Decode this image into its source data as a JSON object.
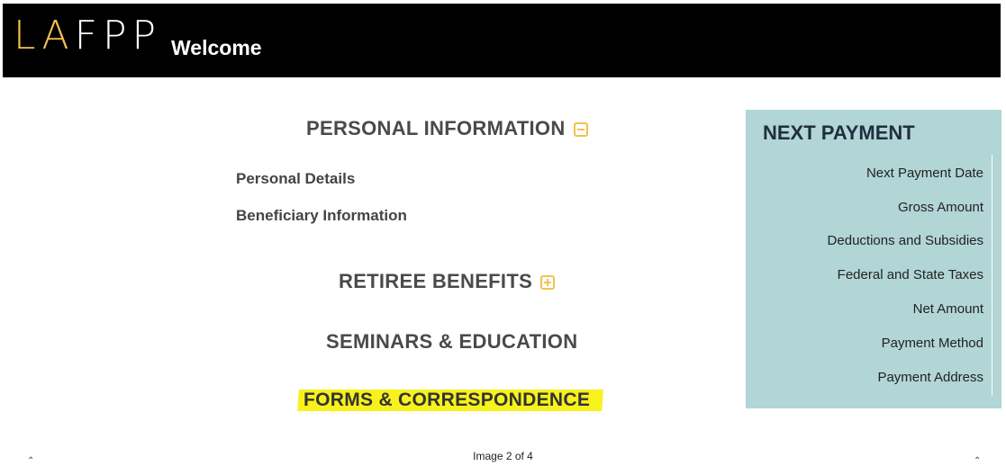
{
  "header": {
    "logo": "LAFPP",
    "welcome": "Welcome"
  },
  "personal_information": {
    "title": "PERSONAL INFORMATION",
    "toggle": "collapse",
    "links": [
      "Personal Details",
      "Beneficiary Information"
    ]
  },
  "retiree_benefits": {
    "title": "RETIREE BENEFITS",
    "toggle": "expand"
  },
  "seminars": {
    "title": "SEMINARS & EDUCATION"
  },
  "forms": {
    "title": "FORMS & CORRESPONDENCE",
    "highlight_color": "#f7f21b"
  },
  "next_payment": {
    "title": "NEXT PAYMENT",
    "items": [
      "Next Payment Date",
      "Gross Amount",
      "Deductions and Subsidies",
      "Federal and State Taxes",
      "Net Amount",
      "Payment Method",
      "Payment Address"
    ],
    "background": "#b2d5d6"
  },
  "footer": {
    "caption": "Image 2 of 4"
  },
  "colors": {
    "accent": "#f2c14e",
    "header_bg": "#000000"
  }
}
